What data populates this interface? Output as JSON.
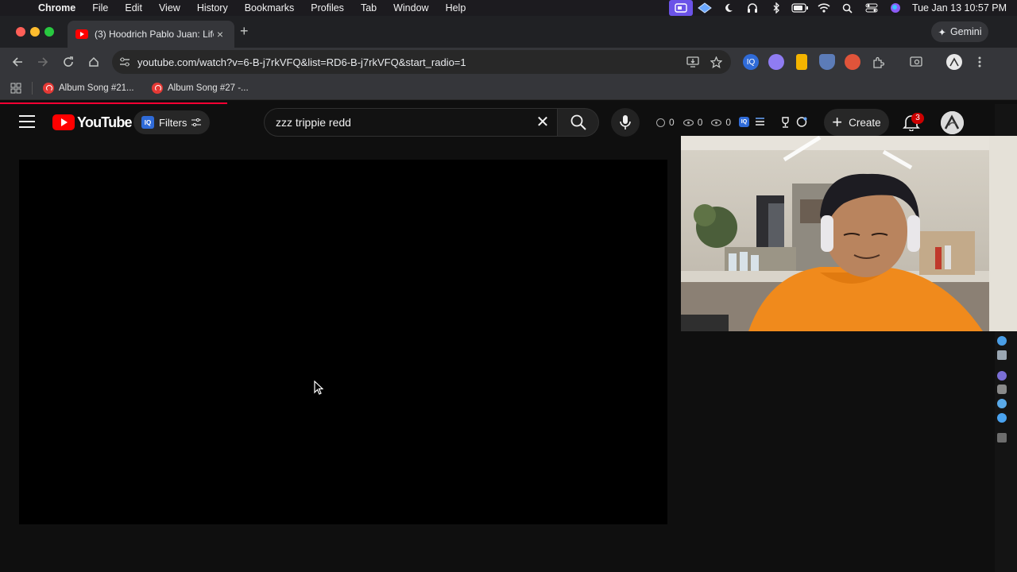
{
  "menubar": {
    "app": "Chrome",
    "items": [
      "File",
      "Edit",
      "View",
      "History",
      "Bookmarks",
      "Profiles",
      "Tab",
      "Window",
      "Help"
    ],
    "clock": "Tue Jan 13  10:57 PM"
  },
  "tab": {
    "title": "(3) Hoodrich Pablo Juan: Life"
  },
  "gemini": {
    "label": "Gemini"
  },
  "omnibox": {
    "url": "youtube.com/watch?v=6-B-j7rkVFQ&list=RD6-B-j7rkVFQ&start_radio=1"
  },
  "bookmarks": [
    {
      "label": "Album Song #21..."
    },
    {
      "label": "Album Song #27 -..."
    }
  ],
  "youtube": {
    "logo_text": "YouTube",
    "filters_label": "Filters",
    "iq_badge": "IQ",
    "search_query": "zzz trippie redd",
    "stats": [
      "0",
      "0",
      "0"
    ],
    "create_label": "Create",
    "notification_count": "3"
  },
  "colors": {
    "accent": "#ff0000",
    "menubar_highlight": "#6b53e8",
    "page_bg": "#0f0f0f"
  }
}
